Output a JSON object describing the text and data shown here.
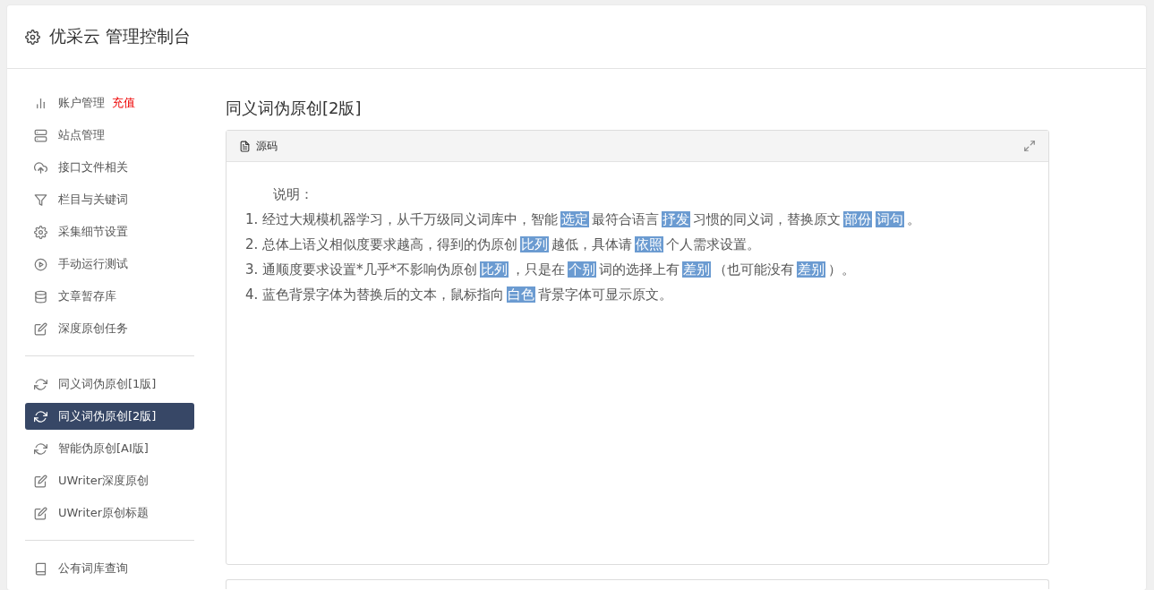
{
  "header": {
    "title": "优采云 管理控制台"
  },
  "sidebar": {
    "groups": [
      {
        "items": [
          {
            "label": "账户管理",
            "badge": "充值",
            "selected": false
          },
          {
            "label": "站点管理",
            "selected": false
          },
          {
            "label": "接口文件相关",
            "selected": false
          },
          {
            "label": "栏目与关键词",
            "selected": false
          },
          {
            "label": "采集细节设置",
            "selected": false
          },
          {
            "label": "手动运行测试",
            "selected": false
          },
          {
            "label": "文章暂存库",
            "selected": false
          },
          {
            "label": "深度原创任务",
            "selected": false
          }
        ]
      },
      {
        "items": [
          {
            "label": "同义词伪原创[1版]",
            "selected": false
          },
          {
            "label": "同义词伪原创[2版]",
            "selected": true
          },
          {
            "label": "智能伪原创[AI版]",
            "selected": false
          },
          {
            "label": "UWriter深度原创",
            "selected": false
          },
          {
            "label": "UWriter原创标题",
            "selected": false
          }
        ]
      },
      {
        "items": [
          {
            "label": "公有词库查询",
            "selected": false
          }
        ]
      }
    ]
  },
  "main": {
    "title": "同义词伪原创[2版]",
    "editor": {
      "toolbar_label": "源码",
      "heading": "说明：",
      "lines": [
        [
          {
            "text": "1. 经过大规模机器学习，从千万级同义词库中，智能",
            "replaced": false
          },
          {
            "text": "选定",
            "replaced": true
          },
          {
            "text": "最符合语言",
            "replaced": false
          },
          {
            "text": "抒发",
            "replaced": true
          },
          {
            "text": "习惯的同义词，替换原文",
            "replaced": false
          },
          {
            "text": "部份",
            "replaced": true
          },
          {
            "text": "词句",
            "replaced": true
          },
          {
            "text": "。",
            "replaced": false
          }
        ],
        [
          {
            "text": "2. 总体上语义相似度要求越高，得到的伪原创",
            "replaced": false
          },
          {
            "text": "比列",
            "replaced": true
          },
          {
            "text": "越低，具体请",
            "replaced": false
          },
          {
            "text": "依照",
            "replaced": true
          },
          {
            "text": "个人需求设置。",
            "replaced": false
          }
        ],
        [
          {
            "text": "3. 通顺度要求设置*几乎*不影响伪原创",
            "replaced": false
          },
          {
            "text": "比列",
            "replaced": true
          },
          {
            "text": "，只是在",
            "replaced": false
          },
          {
            "text": "个别",
            "replaced": true
          },
          {
            "text": "词的选择上有",
            "replaced": false
          },
          {
            "text": "差别",
            "replaced": true
          },
          {
            "text": "（也可能没有",
            "replaced": false
          },
          {
            "text": "差别",
            "replaced": true
          },
          {
            "text": "）。",
            "replaced": false
          }
        ],
        [
          {
            "text": "4. 蓝色背景字体为替换后的文本，鼠标指向",
            "replaced": false
          },
          {
            "text": "白色",
            "replaced": true
          },
          {
            "text": "背景字体可显示原文。",
            "replaced": false
          }
        ]
      ]
    }
  }
}
